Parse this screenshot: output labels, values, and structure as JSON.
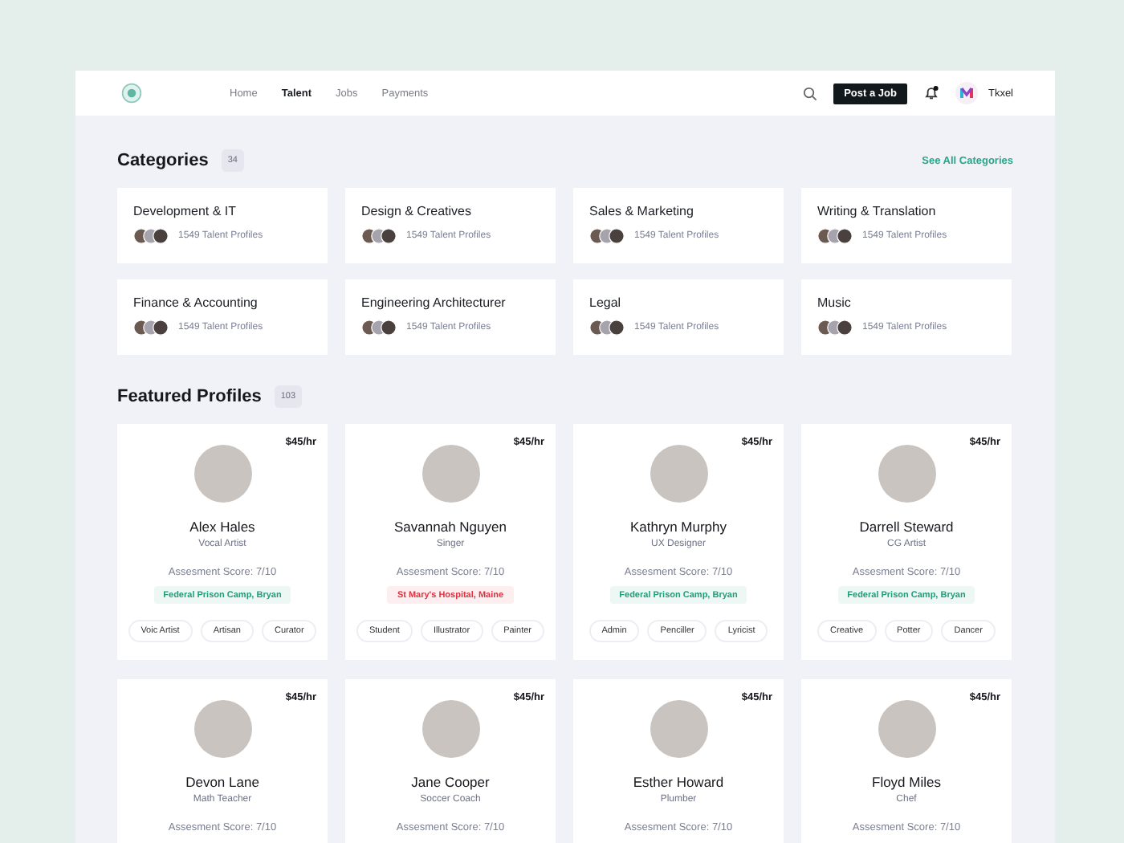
{
  "nav": {
    "links": [
      {
        "label": "Home",
        "selected": false
      },
      {
        "label": "Talent",
        "selected": true
      },
      {
        "label": "Jobs",
        "selected": false
      },
      {
        "label": "Payments",
        "selected": false
      }
    ],
    "post_button": "Post a Job",
    "notifications_unread": true,
    "workspace": "Tkxel"
  },
  "categories": {
    "title": "Categories",
    "count": "34",
    "see_all": "See All Categories",
    "items": [
      {
        "name": "Development & IT",
        "profiles": "1549 Talent Profiles"
      },
      {
        "name": "Design & Creatives",
        "profiles": "1549 Talent Profiles"
      },
      {
        "name": "Sales & Marketing",
        "profiles": "1549 Talent Profiles"
      },
      {
        "name": "Writing & Translation",
        "profiles": "1549 Talent Profiles"
      },
      {
        "name": "Finance & Accounting",
        "profiles": "1549 Talent Profiles"
      },
      {
        "name": "Engineering Architecturer",
        "profiles": "1549 Talent Profiles"
      },
      {
        "name": "Legal",
        "profiles": "1549 Talent Profiles"
      },
      {
        "name": "Music",
        "profiles": "1549 Talent Profiles"
      }
    ]
  },
  "featured": {
    "title": "Featured Profiles",
    "count": "103",
    "profiles": [
      {
        "rate": "$45/hr",
        "name": "Alex Hales",
        "role": "Vocal Artist",
        "score": "Assesment Score: 7/10",
        "location": {
          "text": "Federal Prison Camp, Bryan",
          "color": "#1f9e78"
        },
        "tags": [
          "Voic Artist",
          "Artisan",
          "Curator"
        ]
      },
      {
        "rate": "$45/hr",
        "name": "Savannah Nguyen",
        "role": "Singer",
        "score": "Assesment Score: 7/10",
        "location": {
          "text": "St Mary's Hospital, Maine",
          "color": "#e0313f"
        },
        "tags": [
          "Student",
          "Illustrator",
          "Painter"
        ]
      },
      {
        "rate": "$45/hr",
        "name": "Kathryn Murphy",
        "role": "UX Designer",
        "score": "Assesment Score: 7/10",
        "location": {
          "text": "Federal Prison Camp, Bryan",
          "color": "#1f9e78"
        },
        "tags": [
          "Admin",
          "Penciller",
          "Lyricist"
        ]
      },
      {
        "rate": "$45/hr",
        "name": "Darrell Steward",
        "role": "CG Artist",
        "score": "Assesment Score: 7/10",
        "location": {
          "text": "Federal Prison Camp, Bryan",
          "color": "#1f9e78"
        },
        "tags": [
          "Creative",
          "Potter",
          "Dancer"
        ]
      },
      {
        "rate": "$45/hr",
        "name": "Devon Lane",
        "role": "Math Teacher",
        "score": "Assesment Score: 7/10"
      },
      {
        "rate": "$45/hr",
        "name": "Jane Cooper",
        "role": "Soccer Coach",
        "score": "Assesment Score: 7/10"
      },
      {
        "rate": "$45/hr",
        "name": "Esther Howard",
        "role": "Plumber",
        "score": "Assesment Score: 7/10"
      },
      {
        "rate": "$45/hr",
        "name": "Floyd Miles",
        "role": "Chef",
        "score": "Assesment Score: 7/10"
      }
    ]
  }
}
